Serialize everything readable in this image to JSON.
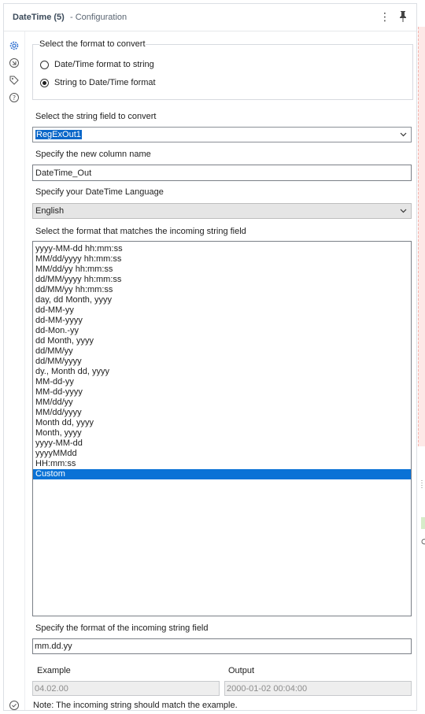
{
  "header": {
    "tool_name": "DateTime (5)",
    "section": "- Configuration"
  },
  "sidebar": {
    "icons": [
      "gear-icon",
      "connection-icon",
      "tag-icon",
      "help-icon",
      "check-circle-icon"
    ]
  },
  "convert_group": {
    "legend": "Select the format to convert",
    "options": [
      {
        "label": "Date/Time format to string",
        "selected": false
      },
      {
        "label": "String to Date/Time format",
        "selected": true
      }
    ]
  },
  "string_field": {
    "label": "Select the string field to convert",
    "value": "RegExOut1"
  },
  "new_column": {
    "label": "Specify the new column name",
    "value": "DateTime_Out"
  },
  "language": {
    "label": "Specify your DateTime Language",
    "value": "English"
  },
  "format_list": {
    "label": "Select the format that matches the incoming string field",
    "items": [
      "yyyy-MM-dd hh:mm:ss",
      "MM/dd/yyyy hh:mm:ss",
      "MM/dd/yy hh:mm:ss",
      "dd/MM/yyyy hh:mm:ss",
      "dd/MM/yy hh:mm:ss",
      "day, dd Month, yyyy",
      "dd-MM-yy",
      "dd-MM-yyyy",
      "dd-Mon.-yy",
      "dd Month, yyyy",
      "dd/MM/yy",
      "dd/MM/yyyy",
      "dy., Month dd, yyyy",
      "MM-dd-yy",
      "MM-dd-yyyy",
      "MM/dd/yy",
      "MM/dd/yyyy",
      "Month dd, yyyy",
      "Month, yyyy",
      "yyyy-MM-dd",
      "yyyyMMdd",
      "HH:mm:ss",
      "Custom"
    ],
    "selected": "Custom"
  },
  "custom_format": {
    "label": "Specify the format of the incoming string field",
    "value": "mm.dd.yy"
  },
  "preview": {
    "example_label": "Example",
    "output_label": "Output",
    "example_value": "04.02.00",
    "output_value": "2000-01-02 00:04:00"
  },
  "note": "Note: The incoming string should match the example."
}
